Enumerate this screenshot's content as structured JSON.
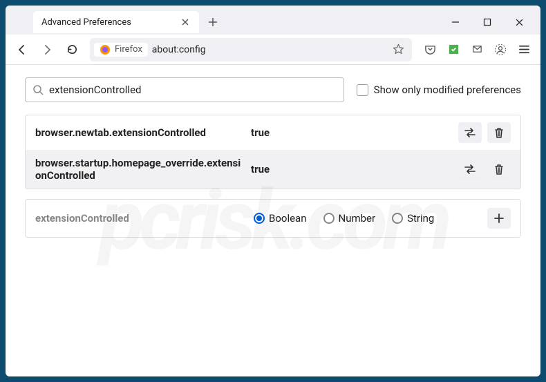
{
  "tab": {
    "title": "Advanced Preferences"
  },
  "url_bar": {
    "identity": "Firefox",
    "url": "about:config"
  },
  "search": {
    "value": "extensionControlled",
    "checkbox_label": "Show only modified preferences"
  },
  "prefs": [
    {
      "name": "browser.newtab.extensionControlled",
      "value": "true"
    },
    {
      "name": "browser.startup.homepage_override.extensionControlled",
      "value": "true"
    }
  ],
  "new_pref": {
    "name": "extensionControlled",
    "types": [
      "Boolean",
      "Number",
      "String"
    ],
    "selected": "Boolean"
  },
  "watermark": "pcrisk.com"
}
